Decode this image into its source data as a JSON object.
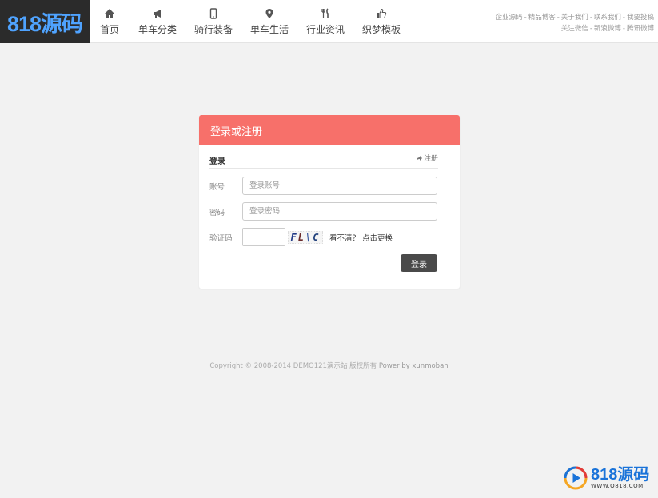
{
  "header": {
    "logo_text": "818源码",
    "nav": [
      {
        "label": "首页",
        "icon": "home-icon"
      },
      {
        "label": "单车分类",
        "icon": "megaphone-icon"
      },
      {
        "label": "骑行装备",
        "icon": "phone-icon"
      },
      {
        "label": "单车生活",
        "icon": "map-pin-icon"
      },
      {
        "label": "行业资讯",
        "icon": "cutlery-icon"
      },
      {
        "label": "织梦模板",
        "icon": "thumbs-up-icon"
      }
    ],
    "top_links_row1": [
      "企业源码",
      "精品博客",
      "关于我们",
      "联系我们",
      "我要投稿"
    ],
    "top_links_row2": [
      "关注微信",
      "新浪微博",
      "腾讯微博"
    ],
    "separator": "-"
  },
  "login": {
    "panel_title": "登录或注册",
    "tab_login": "登录",
    "tab_register": "注册",
    "account_label": "账号",
    "account_placeholder": "登录账号",
    "password_label": "密码",
    "password_placeholder": "登录密码",
    "captcha_label": "验证码",
    "captcha_chars": [
      "F",
      "L",
      "\\",
      "C"
    ],
    "refresh_text": "看不清？ 点击更换",
    "submit_label": "登录"
  },
  "footer": {
    "copyright": "Copyright © 2008-2014 DEMO121演示站 版权所有",
    "powered_by": "Power by xunmoban"
  },
  "watermark": {
    "big_text": "818源码",
    "small_text": "WWW.Q818.COM"
  }
}
